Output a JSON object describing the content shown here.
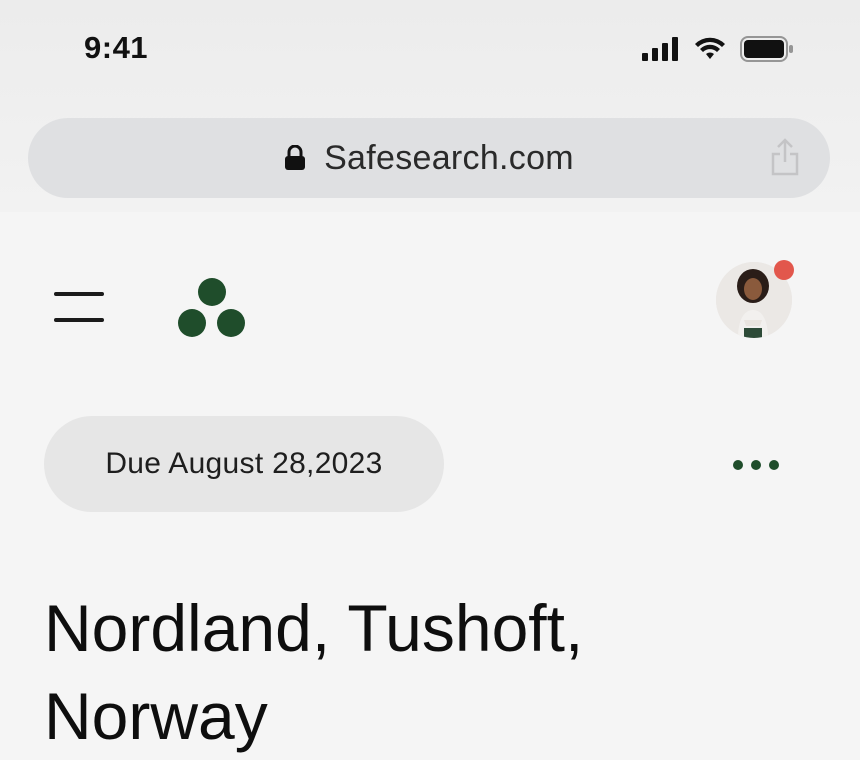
{
  "status_bar": {
    "time": "9:41",
    "icons": [
      "signal-icon",
      "wifi-icon",
      "battery-icon"
    ]
  },
  "browser": {
    "url": "Safesearch.com",
    "icons": [
      "lock-icon",
      "share-icon"
    ]
  },
  "header": {
    "icons": [
      "menu-icon",
      "logo-icon",
      "avatar"
    ],
    "notification_dot_color": "#e2574c",
    "brand_color": "#1f4d2b"
  },
  "task": {
    "due_label": "Due August 28,2023",
    "more_icon": "more-horizontal-icon",
    "location_title": "Nordland, Tushoft, Norway"
  }
}
